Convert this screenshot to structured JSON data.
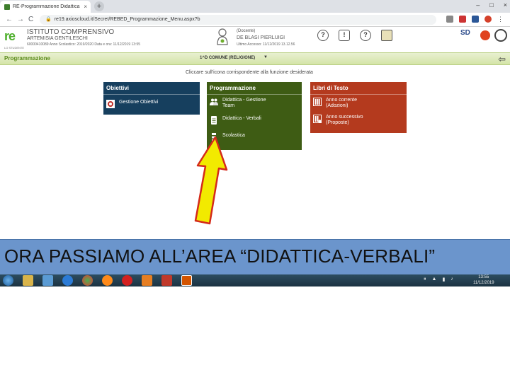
{
  "browser": {
    "tab_title": "RE-Programmazione Didattica",
    "tab_close": "×",
    "new_tab": "+",
    "window_buttons": [
      "–",
      "□",
      "×"
    ],
    "back": "←",
    "forward": "→",
    "reload": "C",
    "url": "re19.axioscloud.it/Secret/REBED_Programmazione_Menu.aspx?b"
  },
  "header": {
    "logo_text": "re",
    "logo_sub": "LO STUDENTE",
    "school_name": "ISTITUTO COMPRENSIVO",
    "school_sub": "ARTEMISIA GENTILESCHI",
    "school_info": "60000410089      Anno Scolastico: 2019/2020    Data e ora: 11/12/2019 13:55",
    "user_role": "(Docente)",
    "user_name": "DE BLASI PIERLUIGI",
    "last_access": "Ultimo Accesso: 11/12/2019 13.12.56",
    "icons": [
      "?",
      "!",
      "?"
    ]
  },
  "greenbar": {
    "title": "Programmazione",
    "class_select": "1^D COMUNE (RELIGIONE)",
    "caret": "▼",
    "back_arrow": "⇦"
  },
  "instruction": "Cliccare sull'icona corrispondente alla funzione desiderata",
  "panels": {
    "obiettivi": {
      "title": "Obiettivi",
      "items": [
        {
          "label": "Gestione Obiettivi"
        }
      ]
    },
    "programmazione": {
      "title": "Programmazione",
      "items": [
        {
          "label": "Didattica - Gestione",
          "sub": "Team"
        },
        {
          "label": "Didattica - Verbali",
          "sub": ""
        },
        {
          "label": "Scolastica",
          "sub": ""
        }
      ]
    },
    "libri": {
      "title": "Libri di Testo",
      "items": [
        {
          "label": "Anno corrente",
          "sub": "(Adozioni)"
        },
        {
          "label": "Anno successivo",
          "sub": "(Proposte)"
        }
      ]
    }
  },
  "caption": "ORA PASSIAMO ALL’AREA “DIDATTICA-VERBALI”",
  "taskbar": {
    "time": "13:55",
    "date": "11/12/2019"
  },
  "colors": {
    "obiettivi_panel": "#163f5e",
    "programmazione_panel": "#3e5c14",
    "libri_panel": "#b43a1e",
    "caption_bg": "#6b95cc",
    "arrow_fill": "#f2ea00",
    "arrow_stroke": "#d42a1a"
  }
}
